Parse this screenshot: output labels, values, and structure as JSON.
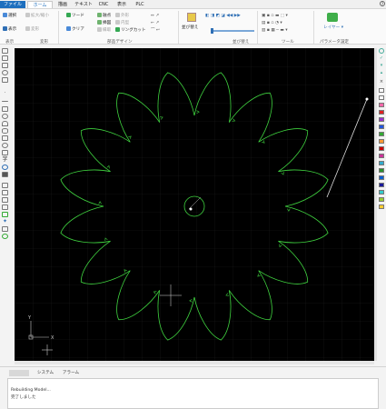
{
  "menu": {
    "tabs": [
      "ファイル",
      "ホーム",
      "描画",
      "テキスト",
      "CNC",
      "表示",
      "PLC"
    ],
    "help_icon": "help-icon"
  },
  "ribbon": {
    "groups": {
      "display": {
        "label": "表示",
        "items": [
          "選択",
          "拡大/縮小",
          "表示",
          "変形"
        ]
      },
      "edit": {
        "label": "変形"
      },
      "design": {
        "label": "部品デザイン",
        "items": [
          "ツード",
          "クリア",
          "融点",
          "外形",
          "挿図",
          "内型",
          "縁取",
          "リングカット"
        ]
      },
      "sort": {
        "label": "並び替え",
        "button": "並び替え"
      },
      "tools": {
        "label": "ツール"
      },
      "param": {
        "label": "パラメータ設定",
        "button": "パラメータ設定"
      }
    }
  },
  "palette_colors": [
    "#ffffff",
    "#ffffff",
    "#ff66aa",
    "#e02020",
    "#9a33cc",
    "#2255dd",
    "#33aa33",
    "#ff9933",
    "#cc0000",
    "#cc3399",
    "#33aacc",
    "#2c8f2c",
    "#0b5fd1",
    "#1a1a9c",
    "#33cccc",
    "#99cc33",
    "#ffcc33"
  ],
  "bottom": {
    "tabs": [
      "",
      "システム",
      "アラーム"
    ],
    "log": [
      "Rebuilding Model...",
      "完了しました"
    ]
  },
  "canvas": {
    "gear_color": "#3fd23f",
    "axis_labels": {
      "x": "X",
      "y": "Y"
    }
  }
}
